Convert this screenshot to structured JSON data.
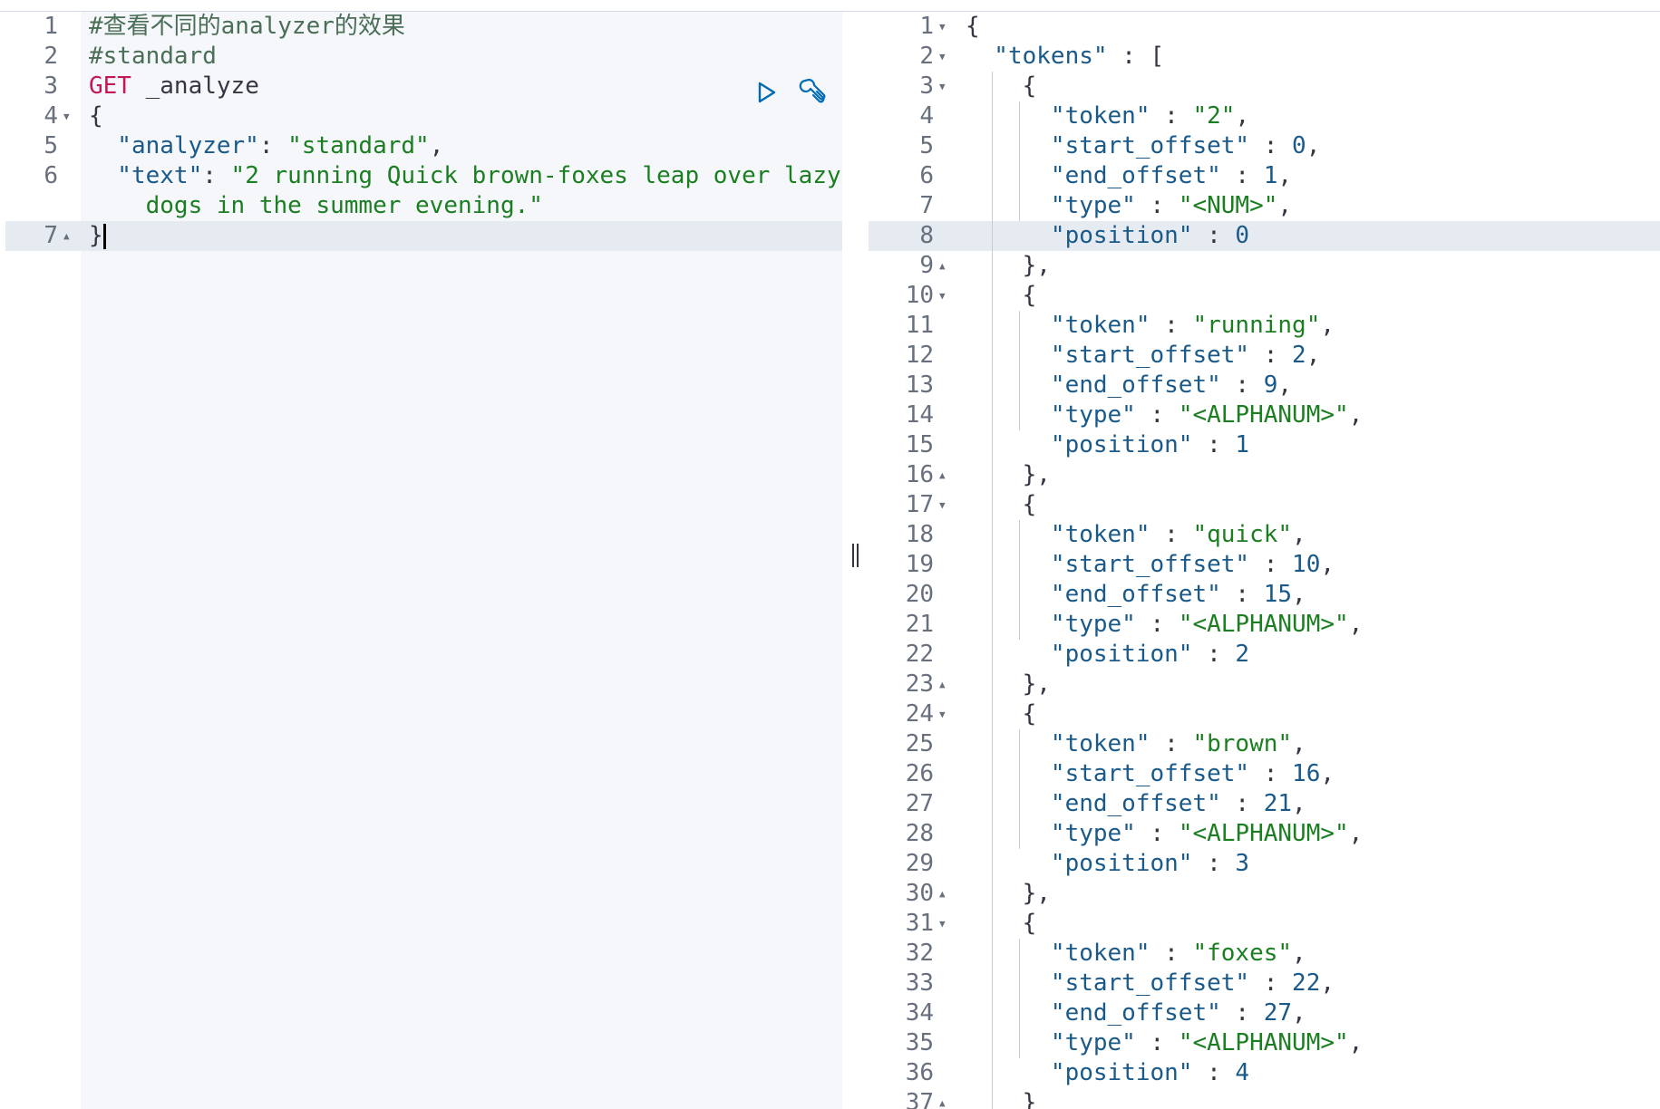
{
  "request": {
    "lines": [
      {
        "n": "1",
        "fold": "",
        "tokens": [
          {
            "t": "#查看不同的analyzer的效果",
            "c": "comment"
          }
        ]
      },
      {
        "n": "2",
        "fold": "",
        "tokens": [
          {
            "t": "#standard",
            "c": "comment"
          }
        ]
      },
      {
        "n": "3",
        "fold": "",
        "tokens": [
          {
            "t": "GET",
            "c": "method"
          },
          {
            "t": " _analyze",
            "c": "url"
          }
        ]
      },
      {
        "n": "4",
        "fold": "▼",
        "tokens": [
          {
            "t": "{",
            "c": "punc"
          }
        ]
      },
      {
        "n": "5",
        "fold": "",
        "tokens": [
          {
            "t": "  \"analyzer\"",
            "c": "key"
          },
          {
            "t": ": ",
            "c": "punc"
          },
          {
            "t": "\"standard\"",
            "c": "str"
          },
          {
            "t": ",",
            "c": "punc"
          }
        ]
      },
      {
        "n": "6",
        "fold": "",
        "tokens": [
          {
            "t": "  \"text\"",
            "c": "key"
          },
          {
            "t": ": ",
            "c": "punc"
          },
          {
            "t": "\"2 running Quick brown-foxes leap over lazy",
            "c": "str"
          }
        ]
      },
      {
        "n": "",
        "fold": "",
        "tokens": [
          {
            "t": "    dogs in the summer evening.\"",
            "c": "str"
          }
        ]
      },
      {
        "n": "7",
        "fold": "▲",
        "tokens": [
          {
            "t": "}",
            "c": "punc"
          },
          {
            "t": "",
            "c": "cursor"
          }
        ]
      }
    ],
    "actions": {
      "run": "play-icon",
      "settings": "wrench-icon"
    }
  },
  "response": {
    "lines": [
      {
        "n": "1",
        "fold": "▼",
        "tokens": [
          {
            "t": "{",
            "c": "punc"
          }
        ]
      },
      {
        "n": "2",
        "fold": "▼",
        "tokens": [
          {
            "t": "  \"tokens\"",
            "c": "key"
          },
          {
            "t": " : [",
            "c": "punc"
          }
        ]
      },
      {
        "n": "3",
        "fold": "▼",
        "tokens": [
          {
            "t": "    {",
            "c": "punc"
          }
        ]
      },
      {
        "n": "4",
        "fold": "",
        "tokens": [
          {
            "t": "      \"token\"",
            "c": "key"
          },
          {
            "t": " : ",
            "c": "punc"
          },
          {
            "t": "\"2\"",
            "c": "str"
          },
          {
            "t": ",",
            "c": "punc"
          }
        ]
      },
      {
        "n": "5",
        "fold": "",
        "tokens": [
          {
            "t": "      \"start_offset\"",
            "c": "key"
          },
          {
            "t": " : ",
            "c": "punc"
          },
          {
            "t": "0",
            "c": "num"
          },
          {
            "t": ",",
            "c": "punc"
          }
        ]
      },
      {
        "n": "6",
        "fold": "",
        "tokens": [
          {
            "t": "      \"end_offset\"",
            "c": "key"
          },
          {
            "t": " : ",
            "c": "punc"
          },
          {
            "t": "1",
            "c": "num"
          },
          {
            "t": ",",
            "c": "punc"
          }
        ]
      },
      {
        "n": "7",
        "fold": "",
        "tokens": [
          {
            "t": "      \"type\"",
            "c": "key"
          },
          {
            "t": " : ",
            "c": "punc"
          },
          {
            "t": "\"<NUM>\"",
            "c": "str"
          },
          {
            "t": ",",
            "c": "punc"
          }
        ]
      },
      {
        "n": "8",
        "fold": "",
        "tokens": [
          {
            "t": "      \"position\"",
            "c": "key"
          },
          {
            "t": " : ",
            "c": "punc"
          },
          {
            "t": "0",
            "c": "num"
          }
        ]
      },
      {
        "n": "9",
        "fold": "▲",
        "tokens": [
          {
            "t": "    },",
            "c": "punc"
          }
        ]
      },
      {
        "n": "10",
        "fold": "▼",
        "tokens": [
          {
            "t": "    {",
            "c": "punc"
          }
        ]
      },
      {
        "n": "11",
        "fold": "",
        "tokens": [
          {
            "t": "      \"token\"",
            "c": "key"
          },
          {
            "t": " : ",
            "c": "punc"
          },
          {
            "t": "\"running\"",
            "c": "str"
          },
          {
            "t": ",",
            "c": "punc"
          }
        ]
      },
      {
        "n": "12",
        "fold": "",
        "tokens": [
          {
            "t": "      \"start_offset\"",
            "c": "key"
          },
          {
            "t": " : ",
            "c": "punc"
          },
          {
            "t": "2",
            "c": "num"
          },
          {
            "t": ",",
            "c": "punc"
          }
        ]
      },
      {
        "n": "13",
        "fold": "",
        "tokens": [
          {
            "t": "      \"end_offset\"",
            "c": "key"
          },
          {
            "t": " : ",
            "c": "punc"
          },
          {
            "t": "9",
            "c": "num"
          },
          {
            "t": ",",
            "c": "punc"
          }
        ]
      },
      {
        "n": "14",
        "fold": "",
        "tokens": [
          {
            "t": "      \"type\"",
            "c": "key"
          },
          {
            "t": " : ",
            "c": "punc"
          },
          {
            "t": "\"<ALPHANUM>\"",
            "c": "str"
          },
          {
            "t": ",",
            "c": "punc"
          }
        ]
      },
      {
        "n": "15",
        "fold": "",
        "tokens": [
          {
            "t": "      \"position\"",
            "c": "key"
          },
          {
            "t": " : ",
            "c": "punc"
          },
          {
            "t": "1",
            "c": "num"
          }
        ]
      },
      {
        "n": "16",
        "fold": "▲",
        "tokens": [
          {
            "t": "    },",
            "c": "punc"
          }
        ]
      },
      {
        "n": "17",
        "fold": "▼",
        "tokens": [
          {
            "t": "    {",
            "c": "punc"
          }
        ]
      },
      {
        "n": "18",
        "fold": "",
        "tokens": [
          {
            "t": "      \"token\"",
            "c": "key"
          },
          {
            "t": " : ",
            "c": "punc"
          },
          {
            "t": "\"quick\"",
            "c": "str"
          },
          {
            "t": ",",
            "c": "punc"
          }
        ]
      },
      {
        "n": "19",
        "fold": "",
        "tokens": [
          {
            "t": "      \"start_offset\"",
            "c": "key"
          },
          {
            "t": " : ",
            "c": "punc"
          },
          {
            "t": "10",
            "c": "num"
          },
          {
            "t": ",",
            "c": "punc"
          }
        ]
      },
      {
        "n": "20",
        "fold": "",
        "tokens": [
          {
            "t": "      \"end_offset\"",
            "c": "key"
          },
          {
            "t": " : ",
            "c": "punc"
          },
          {
            "t": "15",
            "c": "num"
          },
          {
            "t": ",",
            "c": "punc"
          }
        ]
      },
      {
        "n": "21",
        "fold": "",
        "tokens": [
          {
            "t": "      \"type\"",
            "c": "key"
          },
          {
            "t": " : ",
            "c": "punc"
          },
          {
            "t": "\"<ALPHANUM>\"",
            "c": "str"
          },
          {
            "t": ",",
            "c": "punc"
          }
        ]
      },
      {
        "n": "22",
        "fold": "",
        "tokens": [
          {
            "t": "      \"position\"",
            "c": "key"
          },
          {
            "t": " : ",
            "c": "punc"
          },
          {
            "t": "2",
            "c": "num"
          }
        ]
      },
      {
        "n": "23",
        "fold": "▲",
        "tokens": [
          {
            "t": "    },",
            "c": "punc"
          }
        ]
      },
      {
        "n": "24",
        "fold": "▼",
        "tokens": [
          {
            "t": "    {",
            "c": "punc"
          }
        ]
      },
      {
        "n": "25",
        "fold": "",
        "tokens": [
          {
            "t": "      \"token\"",
            "c": "key"
          },
          {
            "t": " : ",
            "c": "punc"
          },
          {
            "t": "\"brown\"",
            "c": "str"
          },
          {
            "t": ",",
            "c": "punc"
          }
        ]
      },
      {
        "n": "26",
        "fold": "",
        "tokens": [
          {
            "t": "      \"start_offset\"",
            "c": "key"
          },
          {
            "t": " : ",
            "c": "punc"
          },
          {
            "t": "16",
            "c": "num"
          },
          {
            "t": ",",
            "c": "punc"
          }
        ]
      },
      {
        "n": "27",
        "fold": "",
        "tokens": [
          {
            "t": "      \"end_offset\"",
            "c": "key"
          },
          {
            "t": " : ",
            "c": "punc"
          },
          {
            "t": "21",
            "c": "num"
          },
          {
            "t": ",",
            "c": "punc"
          }
        ]
      },
      {
        "n": "28",
        "fold": "",
        "tokens": [
          {
            "t": "      \"type\"",
            "c": "key"
          },
          {
            "t": " : ",
            "c": "punc"
          },
          {
            "t": "\"<ALPHANUM>\"",
            "c": "str"
          },
          {
            "t": ",",
            "c": "punc"
          }
        ]
      },
      {
        "n": "29",
        "fold": "",
        "tokens": [
          {
            "t": "      \"position\"",
            "c": "key"
          },
          {
            "t": " : ",
            "c": "punc"
          },
          {
            "t": "3",
            "c": "num"
          }
        ]
      },
      {
        "n": "30",
        "fold": "▲",
        "tokens": [
          {
            "t": "    },",
            "c": "punc"
          }
        ]
      },
      {
        "n": "31",
        "fold": "▼",
        "tokens": [
          {
            "t": "    {",
            "c": "punc"
          }
        ]
      },
      {
        "n": "32",
        "fold": "",
        "tokens": [
          {
            "t": "      \"token\"",
            "c": "key"
          },
          {
            "t": " : ",
            "c": "punc"
          },
          {
            "t": "\"foxes\"",
            "c": "str"
          },
          {
            "t": ",",
            "c": "punc"
          }
        ]
      },
      {
        "n": "33",
        "fold": "",
        "tokens": [
          {
            "t": "      \"start_offset\"",
            "c": "key"
          },
          {
            "t": " : ",
            "c": "punc"
          },
          {
            "t": "22",
            "c": "num"
          },
          {
            "t": ",",
            "c": "punc"
          }
        ]
      },
      {
        "n": "34",
        "fold": "",
        "tokens": [
          {
            "t": "      \"end_offset\"",
            "c": "key"
          },
          {
            "t": " : ",
            "c": "punc"
          },
          {
            "t": "27",
            "c": "num"
          },
          {
            "t": ",",
            "c": "punc"
          }
        ]
      },
      {
        "n": "35",
        "fold": "",
        "tokens": [
          {
            "t": "      \"type\"",
            "c": "key"
          },
          {
            "t": " : ",
            "c": "punc"
          },
          {
            "t": "\"<ALPHANUM>\"",
            "c": "str"
          },
          {
            "t": ",",
            "c": "punc"
          }
        ]
      },
      {
        "n": "36",
        "fold": "",
        "tokens": [
          {
            "t": "      \"position\"",
            "c": "key"
          },
          {
            "t": " : ",
            "c": "punc"
          },
          {
            "t": "4",
            "c": "num"
          }
        ]
      },
      {
        "n": "37",
        "fold": "▲",
        "tokens": [
          {
            "t": "    }",
            "c": "punc"
          }
        ]
      }
    ]
  },
  "colors": {
    "method": "#c2185b",
    "key": "#1a5a8a",
    "string": "#1b7f22",
    "comment": "#4a6e56",
    "highlight": "#e6ebf2"
  },
  "splitter": {
    "icon": "drag-handle-icon"
  }
}
